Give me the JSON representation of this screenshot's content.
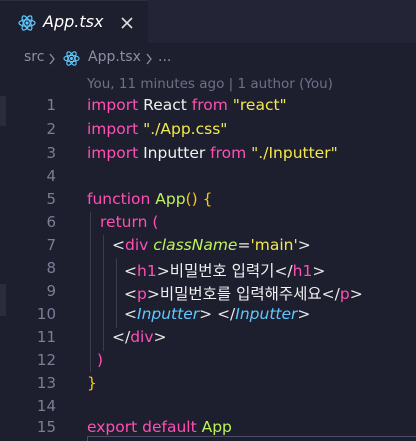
{
  "tab": {
    "label": "App.tsx",
    "icon": "react-icon",
    "close_icon": "close-icon"
  },
  "breadcrumb": {
    "folder": "src",
    "file": "App.tsx",
    "more": "..."
  },
  "blame": "You, 11 minutes ago | 1 author (You)",
  "line_numbers": [
    "1",
    "2",
    "3",
    "4",
    "5",
    "6",
    "7",
    "8",
    "9",
    "10",
    "11",
    "12",
    "13",
    "14",
    "15"
  ],
  "code": {
    "l1": {
      "kw1": "import",
      "id": " React ",
      "kw2": "from",
      "str": " \"react\""
    },
    "l2": {
      "kw1": "import",
      "str": " \"./App.css\""
    },
    "l3": {
      "kw1": "import",
      "id": " Inputter ",
      "kw2": "from",
      "str": " \"./Inputter\""
    },
    "l5": {
      "kw": "function",
      "fn": " App",
      "paren": "()",
      "brace": " {"
    },
    "l6": {
      "kw": "return",
      "paren": " ("
    },
    "l7": {
      "open": "<",
      "tag": "div",
      "attr": " className",
      "eq": "=",
      "val": "'main'",
      "close": ">"
    },
    "l8": {
      "open": "<",
      "tag": "h1",
      "close": ">",
      "text": "비밀번호 입력기",
      "endopen": "</",
      "endtag": "h1",
      "endclose": ">"
    },
    "l9": {
      "open": "<",
      "tag": "p",
      "close": ">",
      "text": "비밀번호를 입력해주세요",
      "endopen": "</",
      "endtag": "p",
      "endclose": ">"
    },
    "l10": {
      "open": "<",
      "tag": "Inputter",
      "close": ">",
      "space": " ",
      "endopen": "</",
      "endtag": "Inputter",
      "endclose": ">"
    },
    "l11": {
      "endopen": "</",
      "endtag": "div",
      "endclose": ">"
    },
    "l12": {
      "paren": ")"
    },
    "l13": {
      "brace": "}"
    },
    "l15": {
      "kw": "export default",
      "id": " App"
    }
  },
  "colors": {
    "background": "#1e1f2e",
    "keyword": "#ff4fb4",
    "string": "#f2e84b",
    "function": "#bdf35a",
    "component": "#5ec8ff"
  }
}
